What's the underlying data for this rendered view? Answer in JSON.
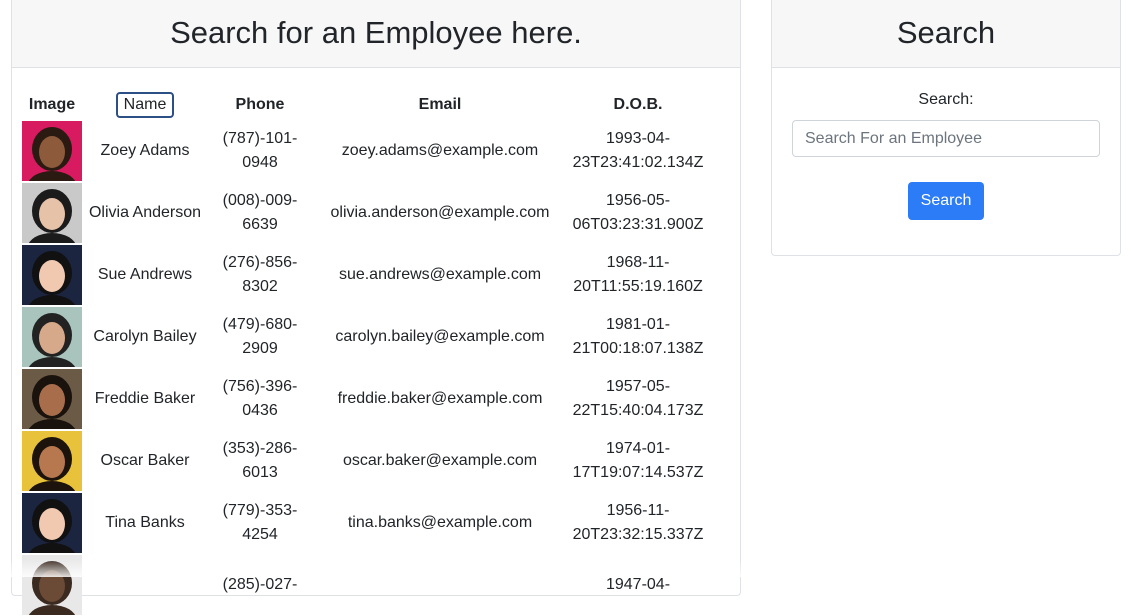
{
  "employee_panel": {
    "title": "Search for an Employee here.",
    "columns": {
      "image": "Image",
      "name": "Name",
      "phone": "Phone",
      "email": "Email",
      "dob": "D.O.B."
    },
    "rows": [
      {
        "name": "Zoey Adams",
        "phone_a": "(787)-101-",
        "phone_b": "0948",
        "email": "zoey.adams@example.com",
        "dob_a": "1993-04-",
        "dob_b": "23T23:41:02.134Z",
        "avatar_bg": "#d81b60",
        "skin": "#8d5a3b",
        "hair": "#2b1a12"
      },
      {
        "name": "Olivia Anderson",
        "phone_a": "(008)-009-",
        "phone_b": "6639",
        "email": "olivia.anderson@example.com",
        "dob_a": "1956-05-",
        "dob_b": "06T03:23:31.900Z",
        "avatar_bg": "#c9c9c9",
        "skin": "#e6c2a8",
        "hair": "#1b1b1b"
      },
      {
        "name": "Sue Andrews",
        "phone_a": "(276)-856-",
        "phone_b": "8302",
        "email": "sue.andrews@example.com",
        "dob_a": "1968-11-",
        "dob_b": "20T11:55:19.160Z",
        "avatar_bg": "#1c2540",
        "skin": "#f0c9b0",
        "hair": "#111111"
      },
      {
        "name": "Carolyn Bailey",
        "phone_a": "(479)-680-",
        "phone_b": "2909",
        "email": "carolyn.bailey@example.com",
        "dob_a": "1981-01-",
        "dob_b": "21T00:18:07.138Z",
        "avatar_bg": "#a9c4bd",
        "skin": "#d7a98b",
        "hair": "#222222"
      },
      {
        "name": "Freddie Baker",
        "phone_a": "(756)-396-",
        "phone_b": "0436",
        "email": "freddie.baker@example.com",
        "dob_a": "1957-05-",
        "dob_b": "22T15:40:04.173Z",
        "avatar_bg": "#6b5a46",
        "skin": "#a86e4c",
        "hair": "#1a120c"
      },
      {
        "name": "Oscar Baker",
        "phone_a": "(353)-286-",
        "phone_b": "6013",
        "email": "oscar.baker@example.com",
        "dob_a": "1974-01-",
        "dob_b": "17T19:07:14.537Z",
        "avatar_bg": "#e9c23b",
        "skin": "#b8784f",
        "hair": "#1c130d"
      },
      {
        "name": "Tina Banks",
        "phone_a": "(779)-353-",
        "phone_b": "4254",
        "email": "tina.banks@example.com",
        "dob_a": "1956-11-",
        "dob_b": "20T23:32:15.337Z",
        "avatar_bg": "#1c2540",
        "skin": "#f0c9b0",
        "hair": "#111111"
      },
      {
        "name": "",
        "phone_a": "(285)-027-",
        "phone_b": "",
        "email": "",
        "dob_a": "1947-04-",
        "dob_b": "",
        "avatar_bg": "#e8e8e8",
        "skin": "#6b4a36",
        "hair": "#3a2a20"
      }
    ]
  },
  "search_panel": {
    "title": "Search",
    "label": "Search:",
    "placeholder": "Search For an Employee",
    "button": "Search"
  }
}
